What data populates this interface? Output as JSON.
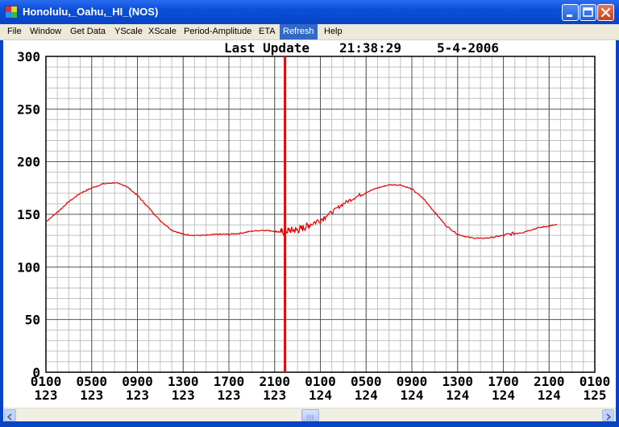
{
  "window": {
    "title": "Honolulu,_Oahu,_HI_(NOS)",
    "icon": "tide-gauge-app-icon",
    "controls": [
      "minimize-icon",
      "maximize-icon",
      "close-icon"
    ]
  },
  "menu": {
    "items": [
      "File",
      "Window",
      "Get Data",
      "YScale",
      "XScale",
      "Period-Amplitude",
      "ETA",
      "Refresh",
      "Help"
    ],
    "active": "Refresh"
  },
  "header": {
    "label": "Last Update",
    "time": "21:38:29",
    "date": "5-4-2006"
  },
  "colors": {
    "series": "#e00000",
    "marker": "#ee0000",
    "grid_major": "#555555",
    "grid_minor": "#c0c0c0",
    "titlebar": "#0a4fd8",
    "menu_active": "#316ac5"
  },
  "chart_data": {
    "type": "line",
    "title": "",
    "xlabel": "",
    "ylabel": "",
    "ylim": [
      0,
      300
    ],
    "yticks": [
      "0",
      "50",
      "100",
      "150",
      "200",
      "250",
      "300"
    ],
    "grid": true,
    "x_ticks": [
      {
        "time": "0100",
        "day": "123"
      },
      {
        "time": "0500",
        "day": "123"
      },
      {
        "time": "0900",
        "day": "123"
      },
      {
        "time": "1300",
        "day": "123"
      },
      {
        "time": "1700",
        "day": "123"
      },
      {
        "time": "2100",
        "day": "123"
      },
      {
        "time": "0100",
        "day": "124"
      },
      {
        "time": "0500",
        "day": "124"
      },
      {
        "time": "0900",
        "day": "124"
      },
      {
        "time": "1300",
        "day": "124"
      },
      {
        "time": "1700",
        "day": "124"
      },
      {
        "time": "2100",
        "day": "124"
      },
      {
        "time": "0100",
        "day": "125"
      }
    ],
    "xlim_hours": [
      0,
      48
    ],
    "marker_hour": 20.9,
    "series": [
      {
        "x_hours": [
          0,
          1,
          2,
          3,
          4,
          5,
          6,
          7,
          8,
          9,
          10,
          11,
          12,
          13,
          14,
          15,
          16,
          17,
          18,
          19,
          20,
          20.5,
          21,
          21.5,
          22,
          22.5,
          23,
          24,
          25,
          26,
          27,
          28,
          29,
          30,
          31,
          32,
          33,
          34,
          35,
          36,
          37,
          38,
          39,
          40,
          41,
          42,
          43,
          44,
          44.7
        ],
        "values": [
          143,
          152,
          162,
          170,
          175,
          179,
          180,
          177,
          168,
          156,
          144,
          135,
          131,
          130,
          130,
          131,
          131,
          132,
          134,
          135,
          134,
          133,
          134,
          135,
          135,
          137,
          140,
          145,
          152,
          160,
          166,
          171,
          175,
          178,
          178,
          174,
          165,
          152,
          139,
          131,
          128,
          127,
          128,
          130,
          132,
          134,
          137,
          139,
          140
        ]
      }
    ]
  }
}
